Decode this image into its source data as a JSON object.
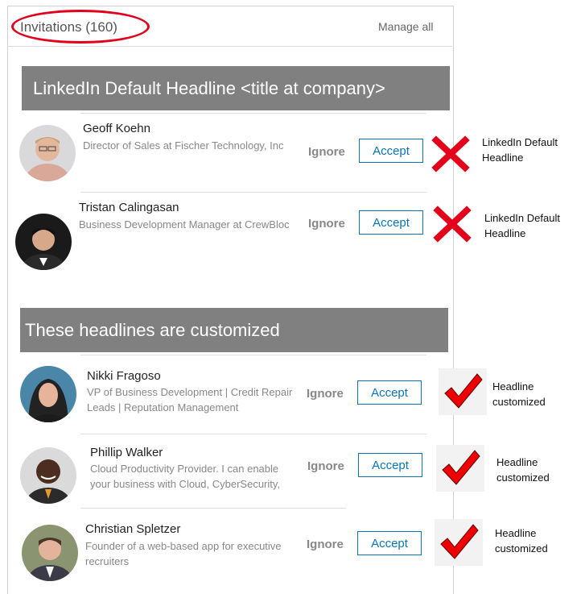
{
  "header": {
    "title": "Invitations (160)",
    "manage_all": "Manage all"
  },
  "banners": {
    "default": "LinkedIn Default Headline  <title at company>",
    "customized": "These headlines are customized"
  },
  "invitations": [
    {
      "name": "Geoff Koehn",
      "headline": "Director of Sales at Fischer Technology, Inc",
      "ignore": "Ignore",
      "accept": "Accept",
      "note": "LinkedIn Default Headline",
      "mark": "x-mark-icon"
    },
    {
      "name": "Tristan Calingasan",
      "headline": "Business Development Manager at CrewBloc",
      "ignore": "Ignore",
      "accept": "Accept",
      "note": "LinkedIn Default Headline",
      "mark": "x-mark-icon"
    },
    {
      "name": "Nikki Fragoso",
      "headline": "VP of Business Development | Credit Repair Leads | Reputation Management",
      "ignore": "Ignore",
      "accept": "Accept",
      "note": "Headline customized",
      "mark": "check-mark-icon"
    },
    {
      "name": "Phillip Walker",
      "headline": "Cloud Productivity Provider. I can enable your business  with Cloud,  CyberSecurity,",
      "ignore": "Ignore",
      "accept": "Accept",
      "note": "Headline customized",
      "mark": "check-mark-icon"
    },
    {
      "name": "Christian Spletzer",
      "headline": "Founder of a web-based app for executive recruiters",
      "ignore": "Ignore",
      "accept": "Accept",
      "note": "Headline customized",
      "mark": "check-mark-icon"
    }
  ],
  "colors": {
    "accept_blue": "#0a74b6",
    "banner_gray": "#808080",
    "annotation_red": "#e2001a"
  }
}
